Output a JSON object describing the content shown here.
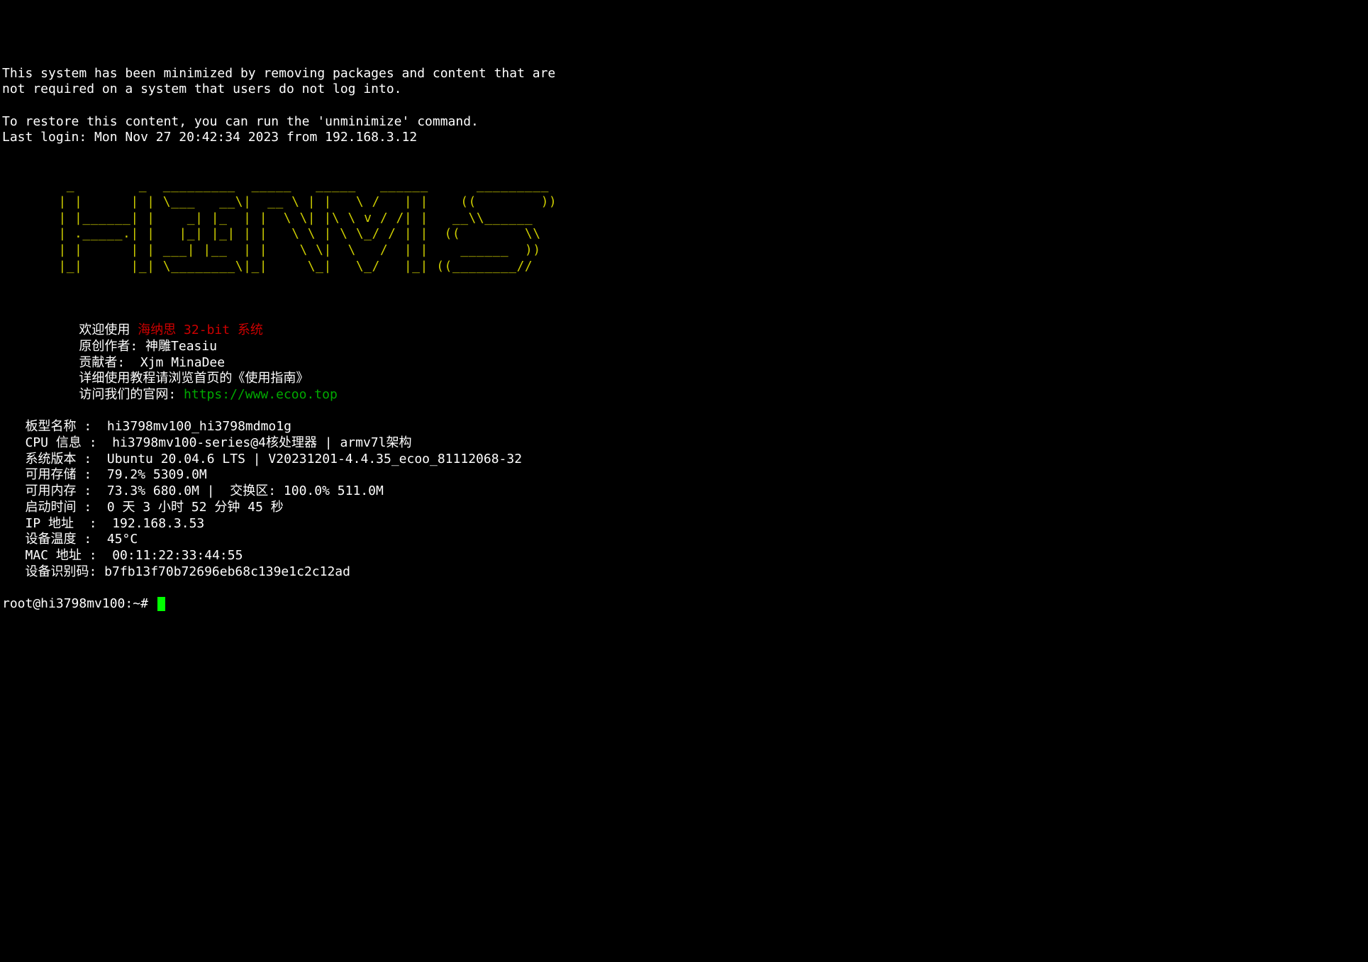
{
  "motd": {
    "line1": "This system has been minimized by removing packages and content that are",
    "line2": "not required on a system that users do not log into.",
    "line3": "",
    "line4": "To restore this content, you can run the 'unminimize' command.",
    "last_login": "Last login: Mon Nov 27 20:42:34 2023 from 192.168.3.12"
  },
  "ascii_banner": "        _        _  _________  _____   _____   ______      _________\n       | |      | | \\___   __\\|  __ \\ | |   \\ /   | |    ((        ))\n       | |______| |    _| |_  | |  \\ \\| |\\ \\ v / /| |   __\\\\______   \n       | ._____.| |   |_| |_| | |   \\ \\ | \\ \\_/ / | |  ((        \\\\  \n       | |      | | ___| |__  | |    \\ \\|  \\   /  | |    ______  ))  \n       |_|      |_| \\________\\|_|     \\_|   \\_/   |_| ((________//   ",
  "welcome": {
    "prefix": "          欢迎使用 ",
    "name": "海纳思",
    "bit": " 32-bit",
    "suffix": " 系统",
    "author_line": "          原创作者: 神雕Teasiu",
    "contributor_line": "          贡献者:  Xjm MinaDee",
    "guide_line": "          详细使用教程请浏览首页的《使用指南》",
    "url_label": "          访问我们的官网: ",
    "url": "https://www.ecoo.top"
  },
  "info": {
    "board": "   板型名称 :  hi3798mv100_hi3798mdmo1g",
    "cpu": "   CPU 信息 :  hi3798mv100-series@4核处理器 | armv7l架构",
    "os": "   系统版本 :  Ubuntu 20.04.6 LTS | V20231201-4.4.35_ecoo_81112068-32",
    "storage": "   可用存储 :  79.2% 5309.0M",
    "memory": "   可用内存 :  73.3% 680.0M |  交换区: 100.0% 511.0M",
    "uptime": "   启动时间 :  0 天 3 小时 52 分钟 45 秒",
    "ip": "   IP 地址  :  192.168.3.53",
    "temp": "   设备温度 :  45°C",
    "mac": "   MAC 地址 :  00:11:22:33:44:55",
    "devid": "   设备识别码: b7fb13f70b72696eb68c139e1c2c12ad"
  },
  "prompt": "root@hi3798mv100:~# "
}
